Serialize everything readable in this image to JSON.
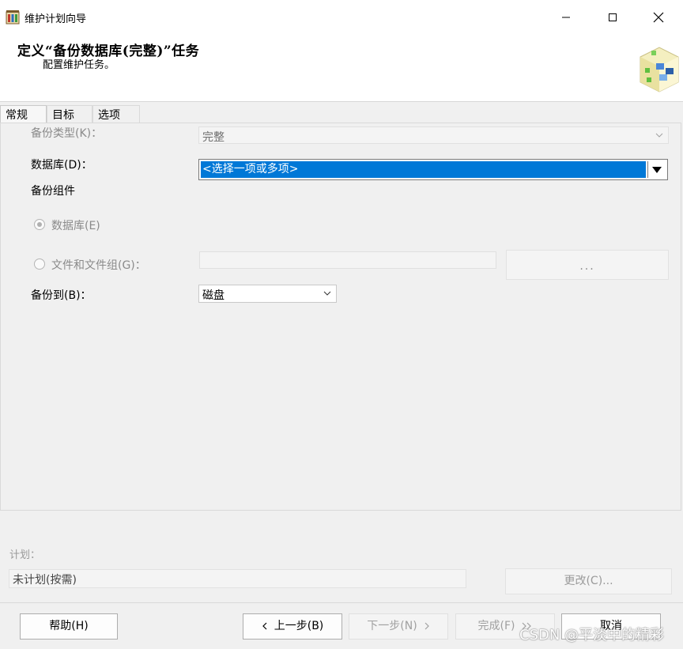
{
  "window": {
    "title": "维护计划向导"
  },
  "header": {
    "title": "定义“备份数据库(完整)”任务",
    "subtitle": "配置维护任务。"
  },
  "tabs": [
    {
      "label": "常规"
    },
    {
      "label": "目标"
    },
    {
      "label": "选项"
    }
  ],
  "general": {
    "backup_type_label": "备份类型(K)：",
    "backup_type_value": "完整",
    "database_label": "数据库(D)：",
    "database_value": "<选择一项或多项>",
    "backup_component_label": "备份组件",
    "radio_database_label": "数据库(E)",
    "radio_files_label": "文件和文件组(G)：",
    "browse_label": "...",
    "backup_to_label": "备份到(B)：",
    "backup_to_value": "磁盘"
  },
  "schedule": {
    "label": "计划：",
    "value": "未计划(按需)",
    "change_label": "更改(C)..."
  },
  "footer": {
    "help_label": "帮助(H)",
    "prev_label": "上一步(B)",
    "next_label": "下一步(N)",
    "finish_label": "完成(F)",
    "cancel_label": "取消"
  },
  "watermark": "CSDN @平淡中的精彩",
  "colors": {
    "selection": "#0078d7",
    "background": "#f0f0f0"
  }
}
